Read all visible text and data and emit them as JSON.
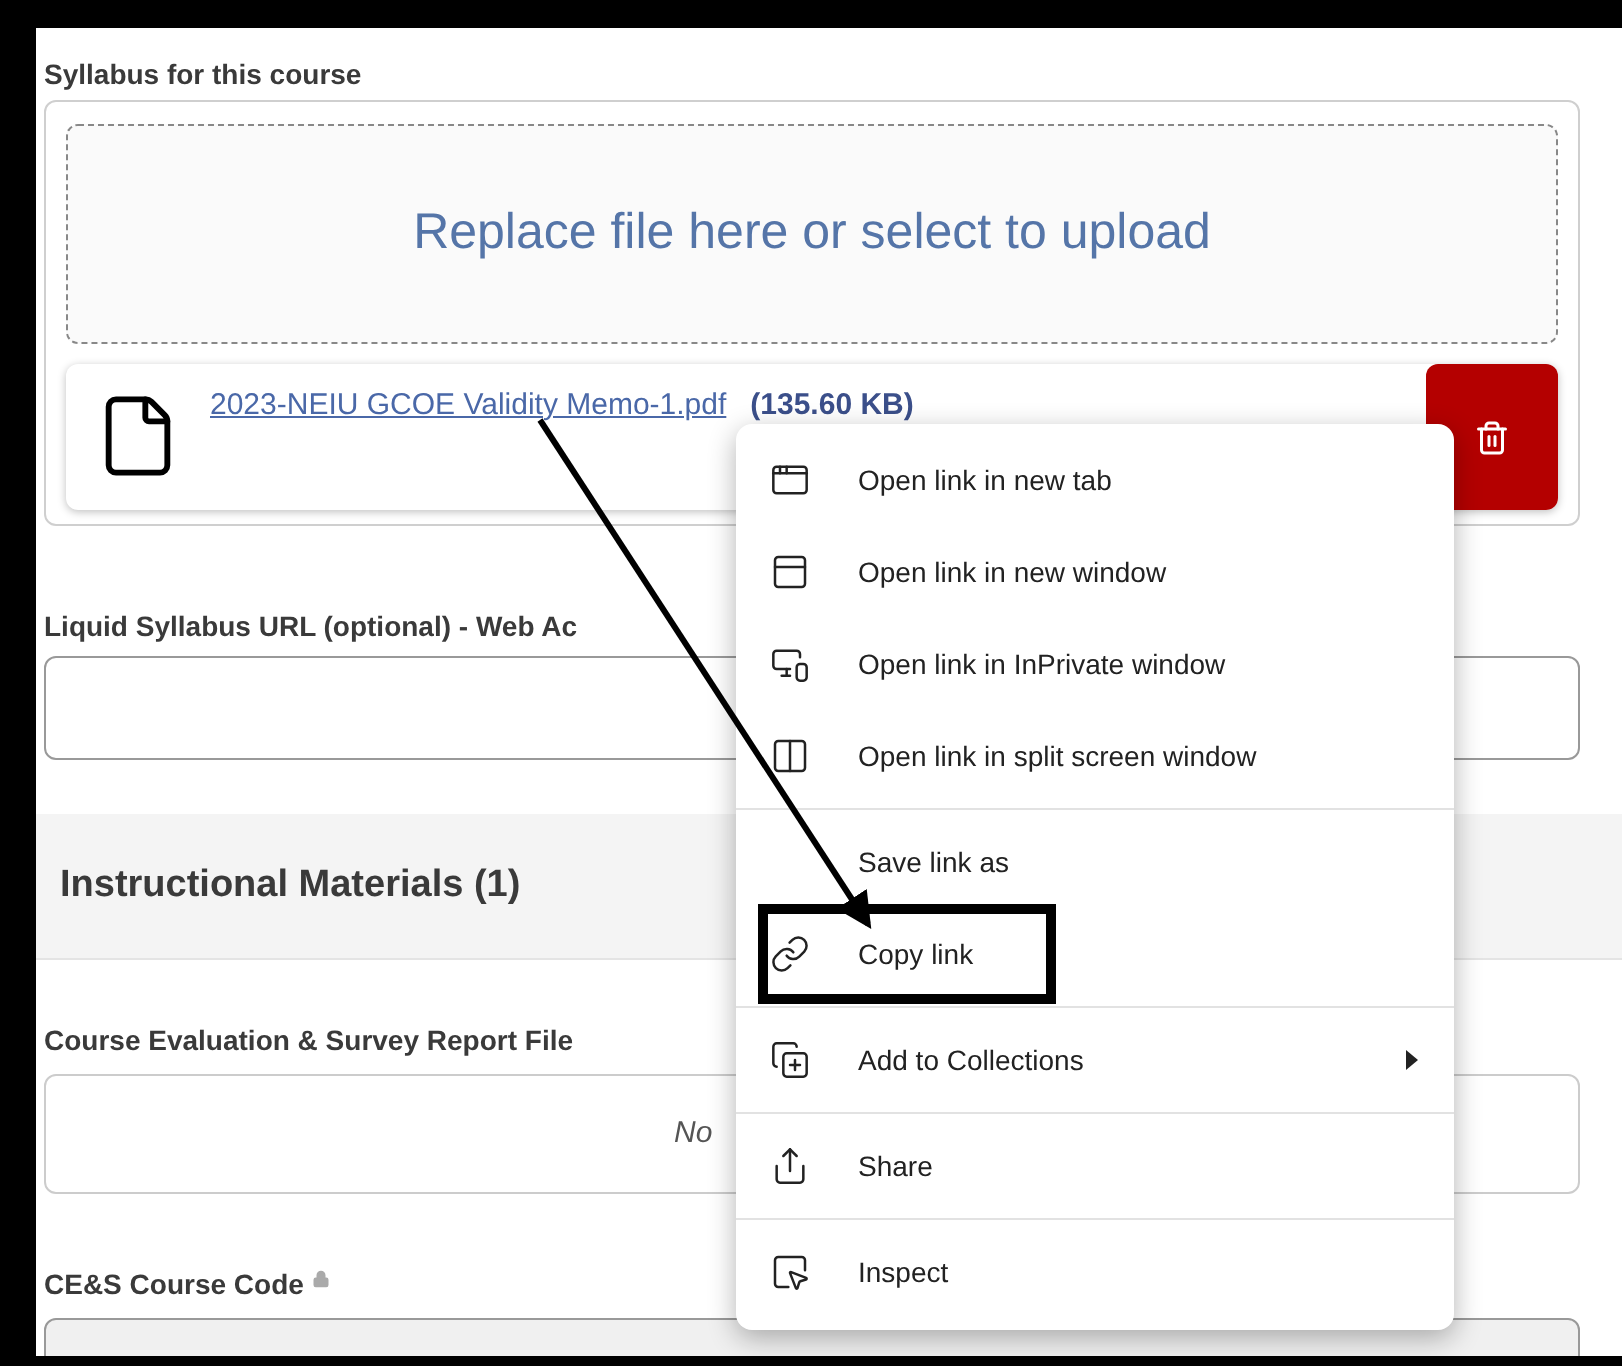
{
  "form": {
    "syllabus": {
      "label": "Syllabus for this course",
      "dropzone": "Replace file here or select to upload",
      "file": {
        "name": "2023-NEIU GCOE Validity Memo-1.pdf",
        "size": "(135.60 KB)"
      }
    },
    "liquid_url": {
      "label": "Liquid Syllabus URL (optional) - Web Ac"
    },
    "section": {
      "title": "Instructional Materials (1)"
    },
    "evaluation": {
      "label": "Course Evaluation & Survey Report File",
      "value": "No"
    },
    "course_code": {
      "label": "CE&S Course Code",
      "locked": true
    }
  },
  "context_menu": {
    "groups": [
      {
        "items": [
          {
            "kind": "tab",
            "label": "Open link in new tab",
            "submenu": false,
            "annotated": false
          },
          {
            "kind": "window",
            "label": "Open link in new window",
            "submenu": false,
            "annotated": false
          },
          {
            "kind": "inprivate",
            "label": "Open link in InPrivate window",
            "submenu": false,
            "annotated": false
          },
          {
            "kind": "split",
            "label": "Open link in split screen window",
            "submenu": false,
            "annotated": false
          }
        ]
      },
      {
        "items": [
          {
            "kind": "none",
            "label": "Save link as",
            "submenu": false,
            "annotated": false
          },
          {
            "kind": "link",
            "label": "Copy link",
            "submenu": false,
            "annotated": true
          }
        ]
      },
      {
        "items": [
          {
            "kind": "collections",
            "label": "Add to Collections",
            "submenu": true,
            "annotated": false
          }
        ]
      },
      {
        "items": [
          {
            "kind": "share",
            "label": "Share",
            "submenu": false,
            "annotated": false
          }
        ]
      },
      {
        "items": [
          {
            "kind": "inspect",
            "label": "Inspect",
            "submenu": false,
            "annotated": false
          }
        ]
      }
    ]
  }
}
